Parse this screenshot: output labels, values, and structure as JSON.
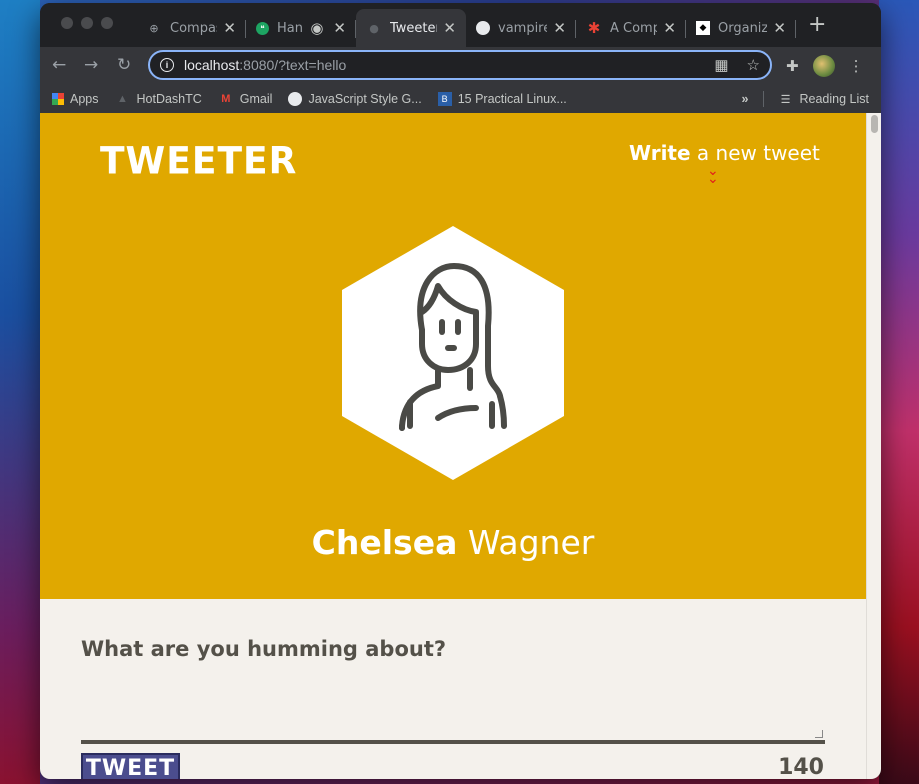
{
  "browser": {
    "tabs": [
      {
        "title": "Compas",
        "icon": "compass-icon"
      },
      {
        "title": "Han",
        "icon": "hangouts-icon"
      },
      {
        "title": "Tweeter",
        "icon": "globe-icon",
        "active": true
      },
      {
        "title": "vampire",
        "icon": "github-icon"
      },
      {
        "title": "A Comp",
        "icon": "asterisk-icon"
      },
      {
        "title": "Organiz",
        "icon": "org-icon"
      }
    ],
    "url_host": "localhost",
    "url_rest": ":8080/?text=hello",
    "bookmarks": [
      {
        "label": "Apps",
        "icon": "apps-grid-icon"
      },
      {
        "label": "HotDashTC",
        "icon": "hotdash-icon"
      },
      {
        "label": "Gmail",
        "icon": "gmail-icon"
      },
      {
        "label": "JavaScript Style G...",
        "icon": "github-icon"
      },
      {
        "label": "15 Practical Linux...",
        "icon": "linux-icon"
      }
    ],
    "reading_list": "Reading List",
    "overflow": "»"
  },
  "page": {
    "brand": "TWEETER",
    "write_bold": "Write",
    "write_rest": " a new tweet",
    "first_name": "Chelsea",
    "last_name": " Wagner",
    "compose_label": "What are you humming about?",
    "tweet_button": "TWEET",
    "counter": "140"
  },
  "colors": {
    "hero": "#e0a800",
    "page_bg": "#f4f1ec",
    "text_dark": "#545149",
    "button": "#4b4d8e",
    "chevron": "#e21c1c"
  }
}
